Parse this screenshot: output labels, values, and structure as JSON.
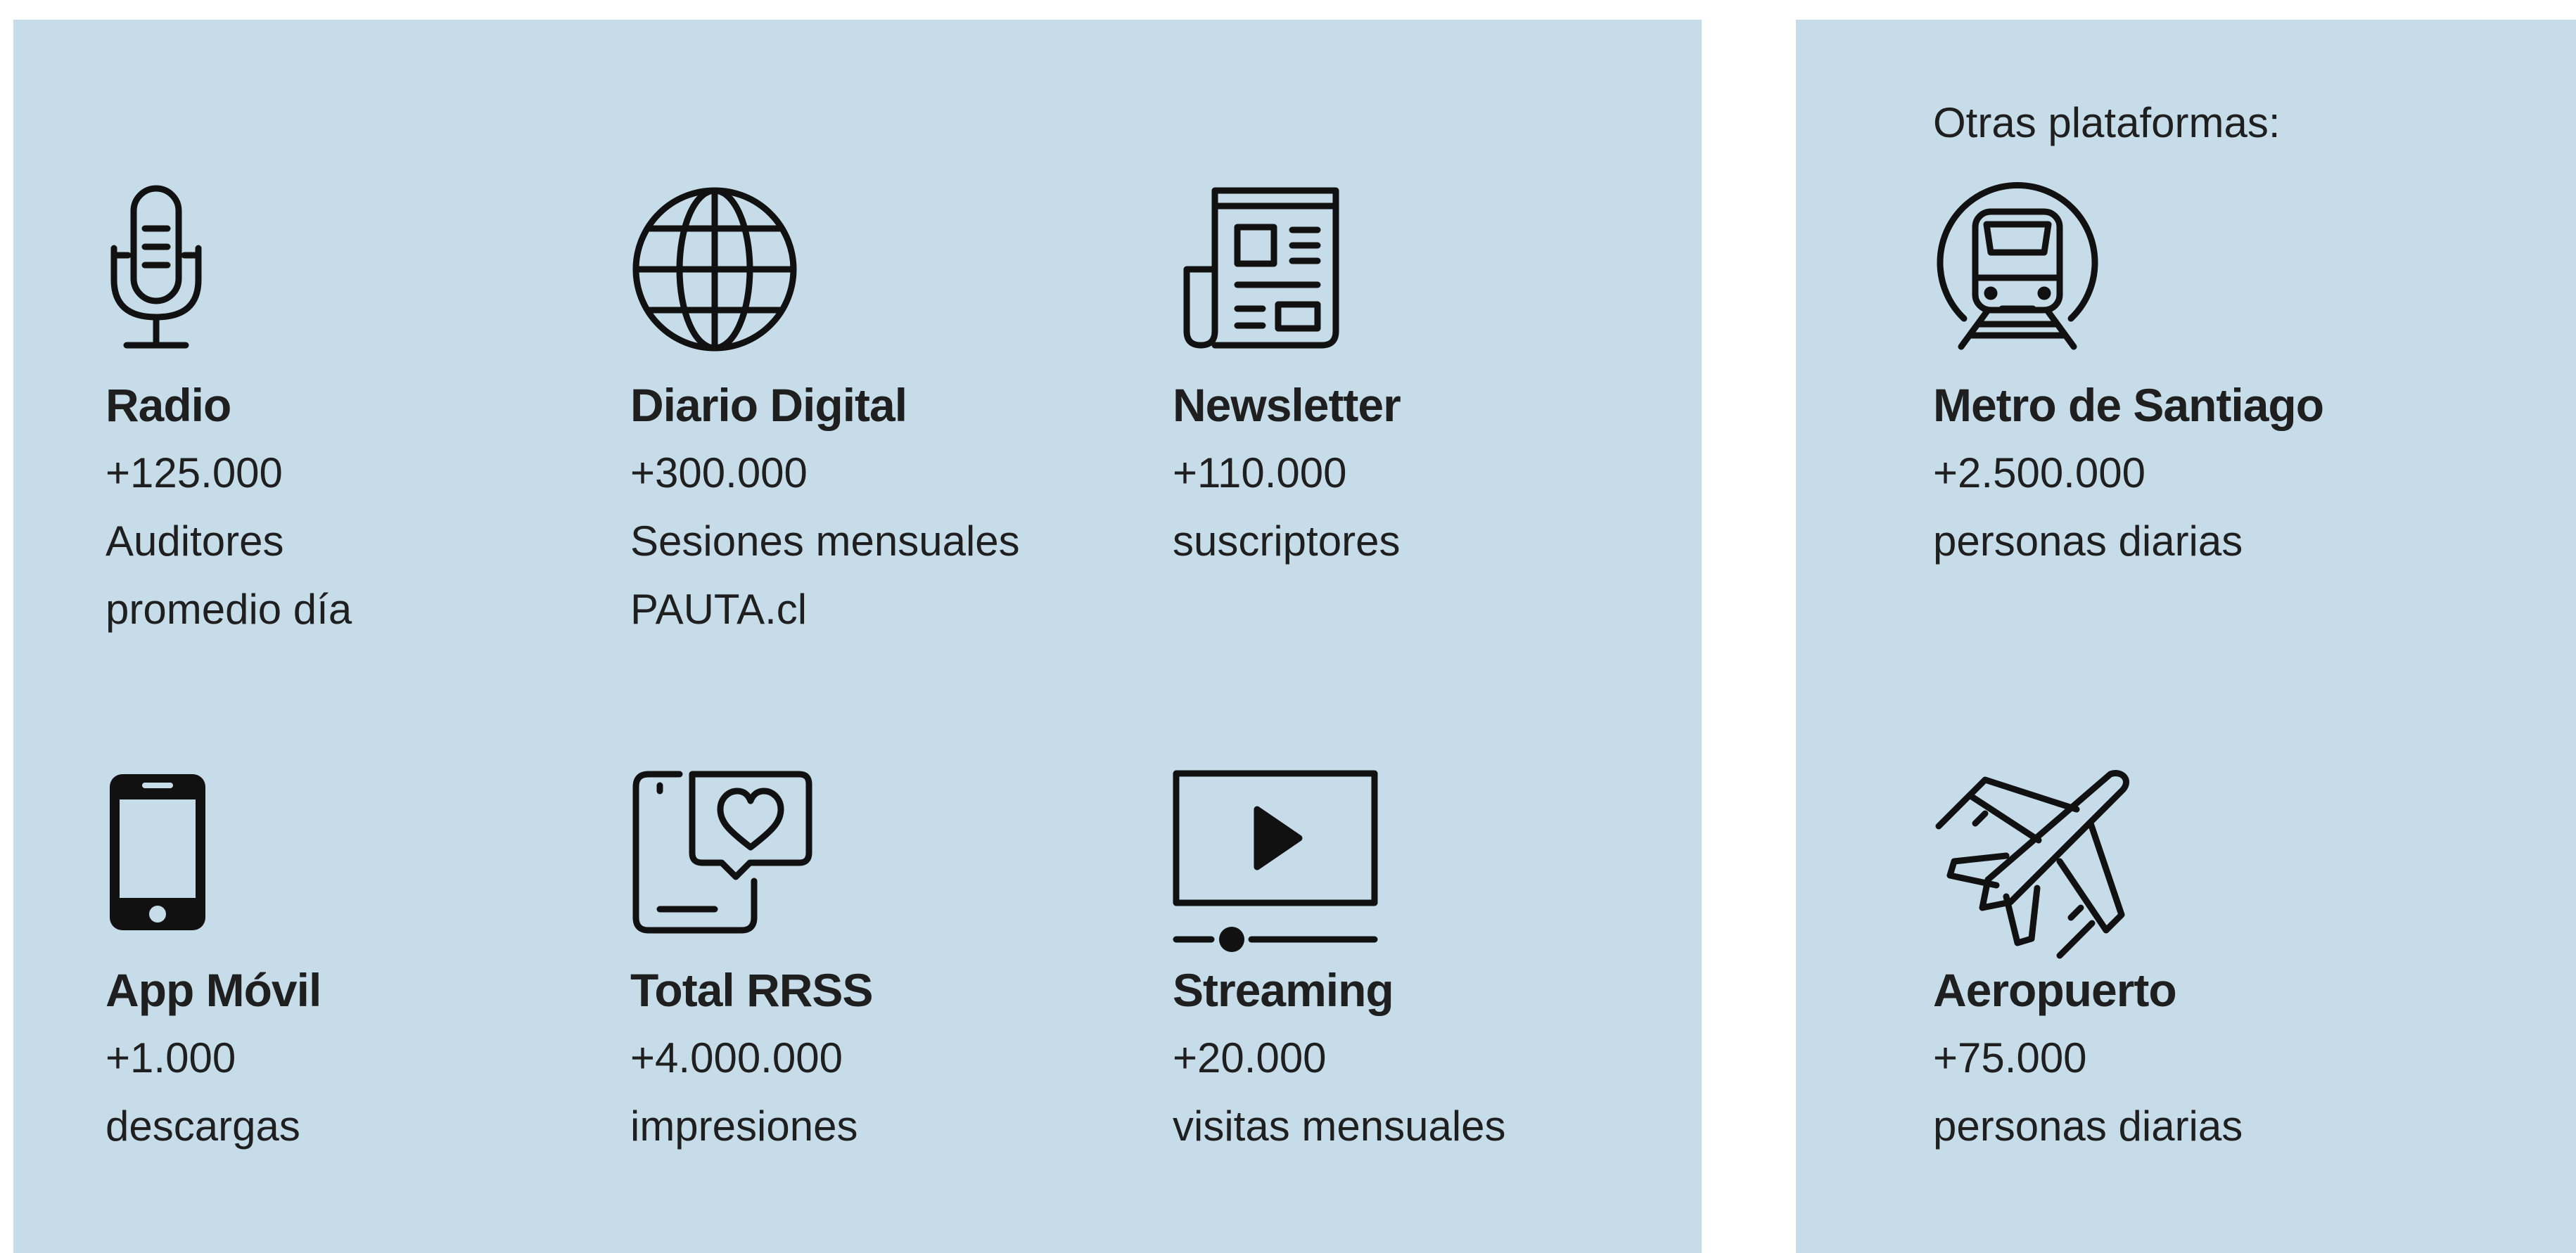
{
  "colors": {
    "panel_background": "#c6dde9",
    "page_background": "#ffffff",
    "text": "#1f1f1f",
    "icon_stroke": "#111111"
  },
  "main_stats": [
    {
      "icon": "microphone-icon",
      "title": "Radio",
      "value": "+125.000",
      "line2": "Auditores",
      "line3": "promedio día"
    },
    {
      "icon": "globe-icon",
      "title": "Diario Digital",
      "value": "+300.000",
      "line2": "Sesiones mensuales",
      "line3": "PAUTA.cl"
    },
    {
      "icon": "newspaper-icon",
      "title": "Newsletter",
      "value": "+110.000",
      "line2": "suscriptores"
    },
    {
      "icon": "smartphone-icon",
      "title": "App Móvil",
      "value": "+1.000",
      "line2": "descargas"
    },
    {
      "icon": "social-heart-icon",
      "title": "Total RRSS",
      "value": "+4.000.000",
      "line2": "impresiones"
    },
    {
      "icon": "video-player-icon",
      "title": "Streaming",
      "value": "+20.000",
      "line2": "visitas mensuales"
    }
  ],
  "other_platforms": {
    "heading": "Otras plataformas:",
    "items": [
      {
        "icon": "metro-train-icon",
        "title": "Metro de Santiago",
        "value": "+2.500.000",
        "line2": "personas diarias"
      },
      {
        "icon": "airplane-icon",
        "title": "Aeropuerto",
        "value": "+75.000",
        "line2": "personas diarias"
      }
    ]
  }
}
